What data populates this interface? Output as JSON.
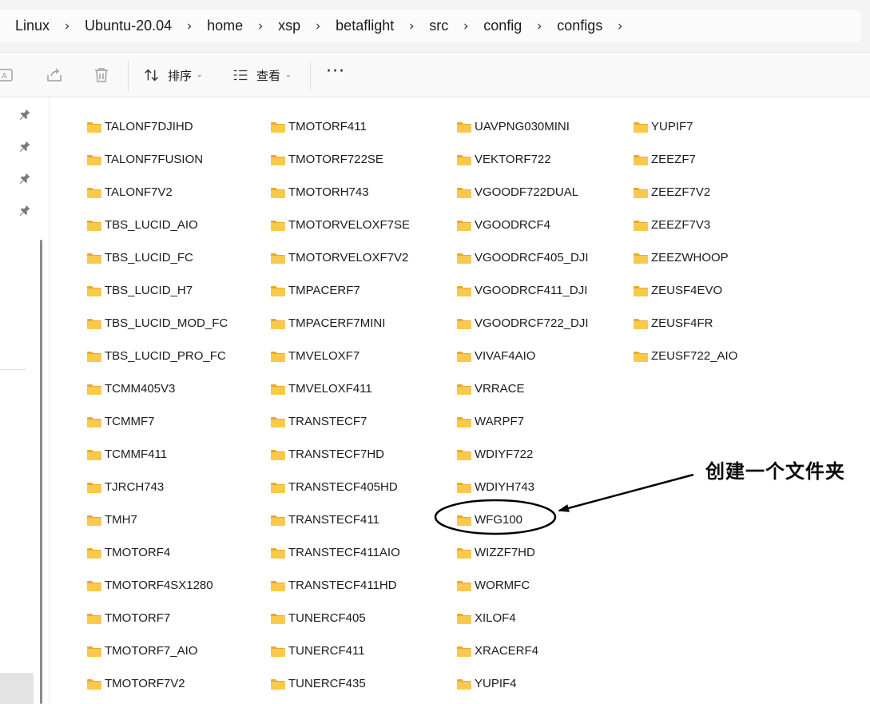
{
  "breadcrumb": [
    "Linux",
    "Ubuntu-20.04",
    "home",
    "xsp",
    "betaflight",
    "src",
    "config",
    "configs"
  ],
  "toolbar": {
    "sort_label": "排序",
    "view_label": "查看",
    "more_label": "···"
  },
  "folders": {
    "col1": [
      "TALONF7DJIHD",
      "TALONF7FUSION",
      "TALONF7V2",
      "TBS_LUCID_AIO",
      "TBS_LUCID_FC",
      "TBS_LUCID_H7",
      "TBS_LUCID_MOD_FC",
      "TBS_LUCID_PRO_FC",
      "TCMM405V3",
      "TCMMF7",
      "TCMMF411",
      "TJRCH743",
      "TMH7",
      "TMOTORF4",
      "TMOTORF4SX1280",
      "TMOTORF7",
      "TMOTORF7_AIO",
      "TMOTORF7V2"
    ],
    "col2": [
      "TMOTORF411",
      "TMOTORF722SE",
      "TMOTORH743",
      "TMOTORVELOXF7SE",
      "TMOTORVELOXF7V2",
      "TMPACERF7",
      "TMPACERF7MINI",
      "TMVELOXF7",
      "TMVELOXF411",
      "TRANSTECF7",
      "TRANSTECF7HD",
      "TRANSTECF405HD",
      "TRANSTECF411",
      "TRANSTECF411AIO",
      "TRANSTECF411HD",
      "TUNERCF405",
      "TUNERCF411",
      "TUNERCF435"
    ],
    "col3": [
      "UAVPNG030MINI",
      "VEKTORF722",
      "VGOODF722DUAL",
      "VGOODRCF4",
      "VGOODRCF405_DJI",
      "VGOODRCF411_DJI",
      "VGOODRCF722_DJI",
      "VIVAF4AIO",
      "VRRACE",
      "WARPF7",
      "WDIYF722",
      "WDIYH743",
      "WFG100",
      "WIZZF7HD",
      "WORMFC",
      "XILOF4",
      "XRACERF4",
      "YUPIF4"
    ],
    "col4": [
      "YUPIF7",
      "ZEEZF7",
      "ZEEZF7V2",
      "ZEEZF7V3",
      "ZEEZWHOOP",
      "ZEUSF4EVO",
      "ZEUSF4FR",
      "ZEUSF722_AIO"
    ]
  },
  "annotation": {
    "text": "创建一个文件夹"
  },
  "colors": {
    "folder_body": "#f8c94a",
    "folder_tab": "#e9a92a",
    "accent": "#000000"
  }
}
